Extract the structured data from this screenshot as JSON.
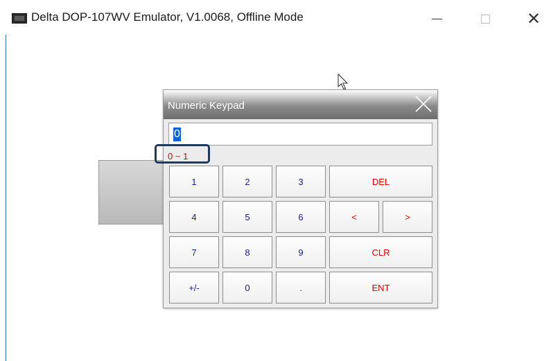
{
  "window": {
    "title": "Delta DOP-107WV Emulator, V1.0068, Offline Mode",
    "minimize_label": "",
    "maximize_label": "",
    "close_label": "✕"
  },
  "keypad": {
    "title": "Numeric Keypad",
    "input_value": "0",
    "range_text": "0 ~ 1",
    "keys": {
      "k1": "1",
      "k2": "2",
      "k3": "3",
      "del": "DEL",
      "k4": "4",
      "k5": "5",
      "k6": "6",
      "left": "<",
      "right": ">",
      "k7": "7",
      "k8": "8",
      "k9": "9",
      "clr": "CLR",
      "sign": "+/-",
      "k0": "0",
      "dot": ".",
      "ent": "ENT"
    }
  },
  "colors": {
    "accent_selection": "#0a66d8",
    "digit_text": "#1a1a8c",
    "action_text": "#e00000",
    "highlight_box": "#1f3a5c"
  }
}
